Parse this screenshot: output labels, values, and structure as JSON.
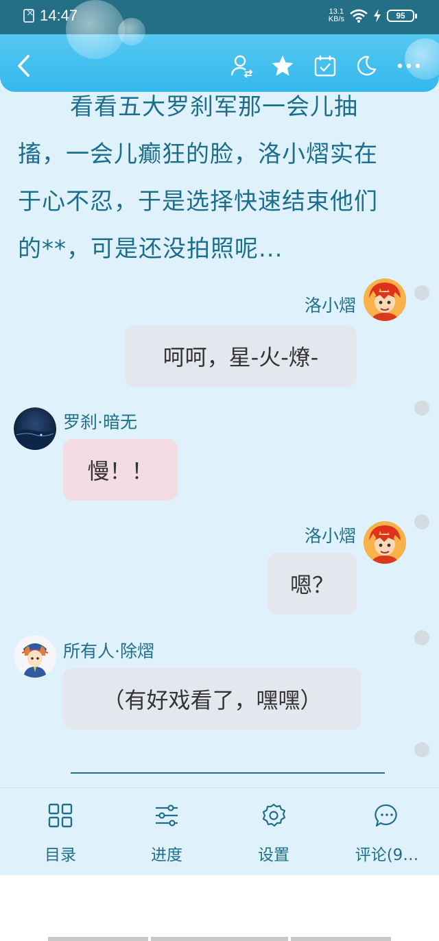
{
  "status_bar": {
    "time": "14:47",
    "net_speed_value": "13.1",
    "net_speed_unit": "KB/s",
    "battery": "95",
    "icons": [
      "sim-icon",
      "wifi-icon",
      "charging-bolt-icon",
      "battery-icon"
    ]
  },
  "toolbar": {
    "icons": [
      "back-icon",
      "switch-user-icon",
      "star-icon",
      "calendar-icon",
      "night-mode-icon",
      "more-icon"
    ]
  },
  "story": {
    "paragraph": "看看五大罗刹军那一会儿抽搐，一会儿癫狂的脸，洛小熠实在于心不忍，于是选择快速结束他们的**，可是还没拍照呢..."
  },
  "messages": [
    {
      "speaker": "洛小熠",
      "text": "呵呵，星-火-燎-",
      "side": "right",
      "bubble_color": "#e4e8ee"
    },
    {
      "speaker": "罗刹·暗无",
      "text": "慢！！",
      "side": "left",
      "bubble_color": "#f4dde2"
    },
    {
      "speaker": "洛小熠",
      "text": "嗯？",
      "side": "right",
      "bubble_color": "#e4e8ee"
    },
    {
      "speaker": "所有人·除熠",
      "text": "（有好戏看了，嘿嘿）",
      "side": "left",
      "bubble_color": "#e4e8ee"
    }
  ],
  "bottom_nav": [
    {
      "label": "目录",
      "icon": "grid-icon"
    },
    {
      "label": "进度",
      "icon": "sliders-icon"
    },
    {
      "label": "设置",
      "icon": "gear-icon"
    },
    {
      "label": "评论(9…",
      "icon": "comment-icon"
    }
  ],
  "colors": {
    "status_bar": "#246f85",
    "toolbar": "#3bbcee",
    "reader_bg": "#dff2fb",
    "text": "#1d6e8c"
  }
}
